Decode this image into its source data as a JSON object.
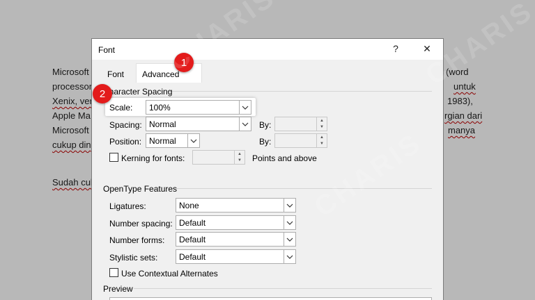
{
  "document": {
    "lines_left": [
      "Microsoft",
      "processor",
      "Xenix, ver",
      "Apple Ma",
      "Microsoft",
      "cukup din"
    ],
    "lines_right": [
      "(word",
      "untuk",
      "1983),",
      "rgian dari",
      "manya"
    ],
    "line_bottom": "Sudah cuk"
  },
  "dialog": {
    "title": "Font",
    "help_label": "?",
    "close_label": "✕",
    "tabs": {
      "font": "Font",
      "advanced": "Advanced"
    },
    "character_spacing": {
      "heading": "Character Spacing",
      "scale_label": "Scale:",
      "scale_value": "100%",
      "spacing_label": "Spacing:",
      "spacing_value": "Normal",
      "spacing_by_label": "By:",
      "position_label": "Position:",
      "position_value": "Normal",
      "position_by_label": "By:",
      "kerning_label": "Kerning for fonts:",
      "kerning_suffix": "Points and above"
    },
    "opentype": {
      "heading": "OpenType Features",
      "ligatures_label": "Ligatures:",
      "ligatures_value": "None",
      "number_spacing_label": "Number spacing:",
      "number_spacing_value": "Default",
      "number_forms_label": "Number forms:",
      "number_forms_value": "Default",
      "stylistic_sets_label": "Stylistic sets:",
      "stylistic_sets_value": "Default",
      "contextual_label": "Use Contextual Alternates"
    },
    "preview_heading": "Preview"
  },
  "annotations": {
    "badge1": "1",
    "badge2": "2"
  },
  "watermark": "CHARIS",
  "colors": {
    "badge": "#e31b1b"
  }
}
